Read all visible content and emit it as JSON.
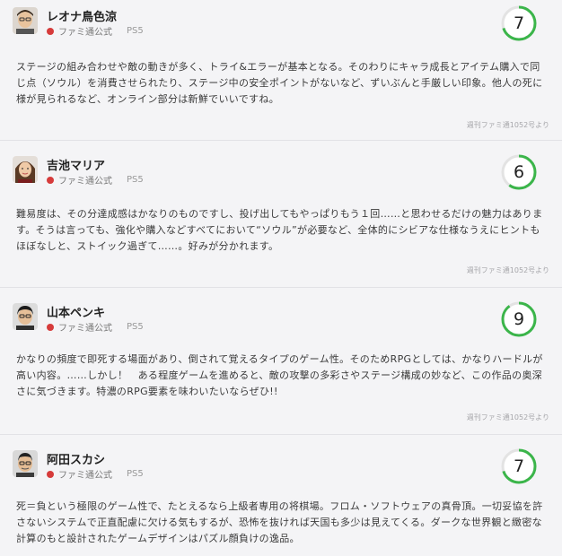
{
  "reviews": [
    {
      "reviewer": "レオナ鳥色涼",
      "outlet": "ファミ通公式",
      "platform": "PS5",
      "score": "7",
      "score_value": 7,
      "text": "ステージの組み合わせや敵の動きが多く、トライ&エラーが基本となる。そのわりにキャラ成長とアイテム購入で同じ点（ソウル）を消費させられたり、ステージ中の安全ポイントがないなど、ずいぶんと手厳しい印象。他人の死に様が見られるなど、オンライン部分は新鮮でいいですね。",
      "source": "週刊ファミ通1052号より"
    },
    {
      "reviewer": "吉池マリア",
      "outlet": "ファミ通公式",
      "platform": "PS5",
      "score": "6",
      "score_value": 6,
      "text": "難易度は、その分達成感はかなりのものですし、投げ出してもやっぱりもう１回……と思わせるだけの魅力はあります。そうは言っても、強化や購入などすべてにおいて“ソウル”が必要など、全体的にシビアな仕様なうえにヒントもほぼなしと、ストイック過ぎて……。好みが分かれます。",
      "source": "週刊ファミ通1052号より"
    },
    {
      "reviewer": "山本ペンキ",
      "outlet": "ファミ通公式",
      "platform": "PS5",
      "score": "9",
      "score_value": 9,
      "text": "かなりの頻度で即死する場面があり、倒されて覚えるタイプのゲーム性。そのためRPGとしては、かなりハードルが高い内容。……しかし！　ある程度ゲームを進めると、敵の攻撃の多彩さやステージ構成の妙など、この作品の奥深さに気づきます。特濃のRPG要素を味わいたいならぜひ!!",
      "source": "週刊ファミ通1052号より"
    },
    {
      "reviewer": "阿田スカシ",
      "outlet": "ファミ通公式",
      "platform": "PS5",
      "score": "7",
      "score_value": 7,
      "text": "死＝負という極限のゲーム性で、たとえるなら上級者専用の将棋場。フロム・ソフトウェアの真骨頂。一切妥協を許さないシステムで正直配慮に欠ける気もするが、恐怖を抜ければ天国も多少は見えてくる。ダークな世界観と緻密な計算のもと設計されたゲームデザインはパズル顔負けの逸品。",
      "source": ""
    }
  ],
  "colors": {
    "ring_fill": "#3bb54a",
    "ring_track": "#e3e3e3",
    "outlet_dot": "#d63b3b"
  },
  "icons": {
    "avatar": "reviewer-avatar-icon",
    "outlet": "famitsu-red-dot-icon"
  }
}
